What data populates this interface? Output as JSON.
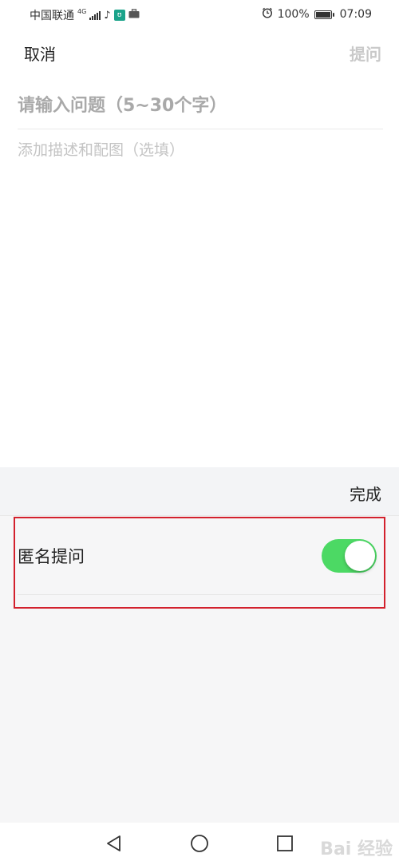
{
  "status_bar": {
    "carrier": "中国联通",
    "network": "4G",
    "battery_percent": "100%",
    "time": "07:09",
    "icons": [
      "signal-icon",
      "tiktok-icon",
      "app-notification-icon",
      "briefcase-icon",
      "alarm-icon",
      "battery-icon"
    ]
  },
  "header": {
    "cancel_label": "取消",
    "ask_label": "提问"
  },
  "form": {
    "title_placeholder": "请输入问题（5~30个字）",
    "title_value": "",
    "description_placeholder": "添加描述和配图（选填）",
    "description_value": ""
  },
  "panel": {
    "done_label": "完成",
    "anonymous_label": "匿名提问",
    "anonymous_enabled": true
  },
  "nav": {
    "icons": [
      "back-icon",
      "home-icon",
      "recent-apps-icon"
    ]
  },
  "watermark": "Bai 经验",
  "colors": {
    "toggle_on": "#4cd964",
    "highlight": "#d3212d",
    "disabled_text": "#c9c9c9"
  }
}
